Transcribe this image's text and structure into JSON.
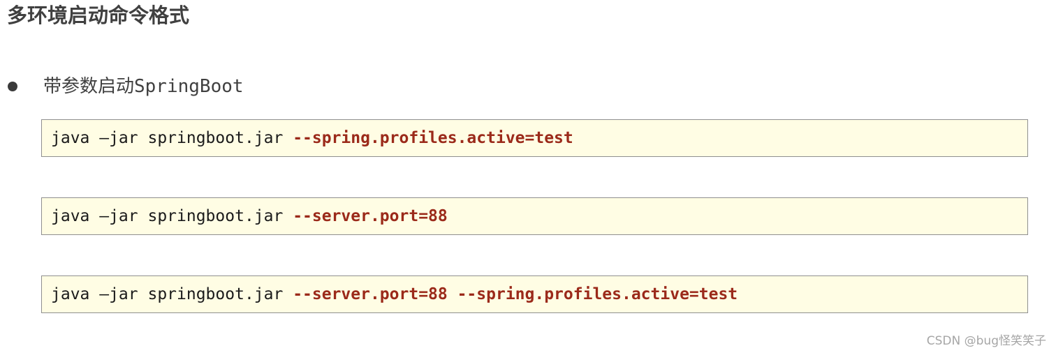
{
  "page": {
    "title": "多环境启动命令格式"
  },
  "bullet": {
    "text": "带参数启动SpringBoot"
  },
  "code_blocks": [
    {
      "command": "java –jar springboot.jar ",
      "args": "--spring.profiles.active=test"
    },
    {
      "command": "java –jar springboot.jar ",
      "args": "--server.port=88"
    },
    {
      "command": "java –jar springboot.jar ",
      "args": "--server.port=88 --spring.profiles.active=test"
    }
  ],
  "watermark": {
    "text": "CSDN @bug怪笑笑子"
  },
  "colors": {
    "code_background": "#fffde4",
    "code_border": "#8f8f8f",
    "argument_text": "#9b2a1a",
    "command_text": "#1a1a1a",
    "heading_text": "#404040"
  },
  "icons": {
    "bullet": "bullet-dot-icon"
  }
}
